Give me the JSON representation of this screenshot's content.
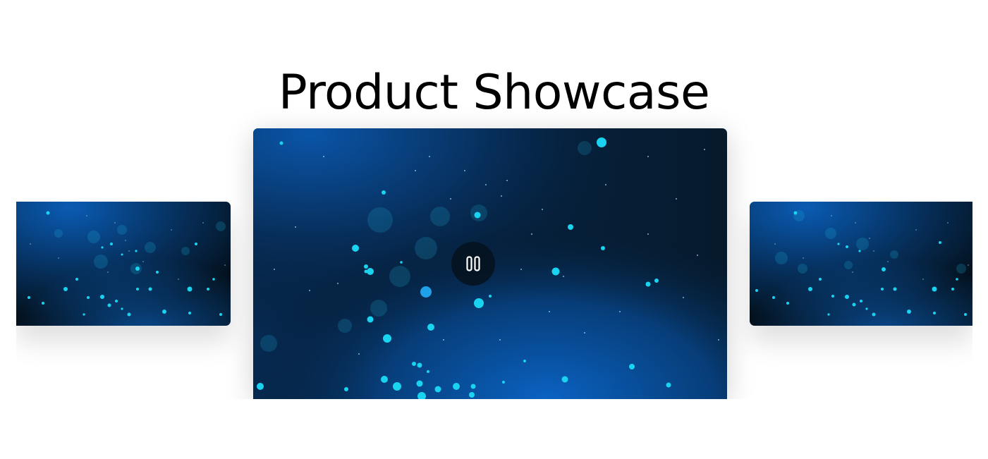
{
  "page": {
    "title": "Product Showcase"
  },
  "carousel": {
    "slides": [
      {
        "position": "previous",
        "media": "blue-bokeh-particles-video"
      },
      {
        "position": "current",
        "media": "blue-bokeh-particles-video",
        "state": "playing"
      },
      {
        "position": "next",
        "media": "blue-bokeh-particles-video"
      }
    ],
    "controls": {
      "pause_icon": "pause-icon"
    }
  },
  "colors": {
    "background": "#ffffff",
    "title": "#000000",
    "video_deep": "#04101c",
    "video_blue": "#0b4f9a",
    "particle": "#19d3f0",
    "control_bg": "#06121e"
  }
}
